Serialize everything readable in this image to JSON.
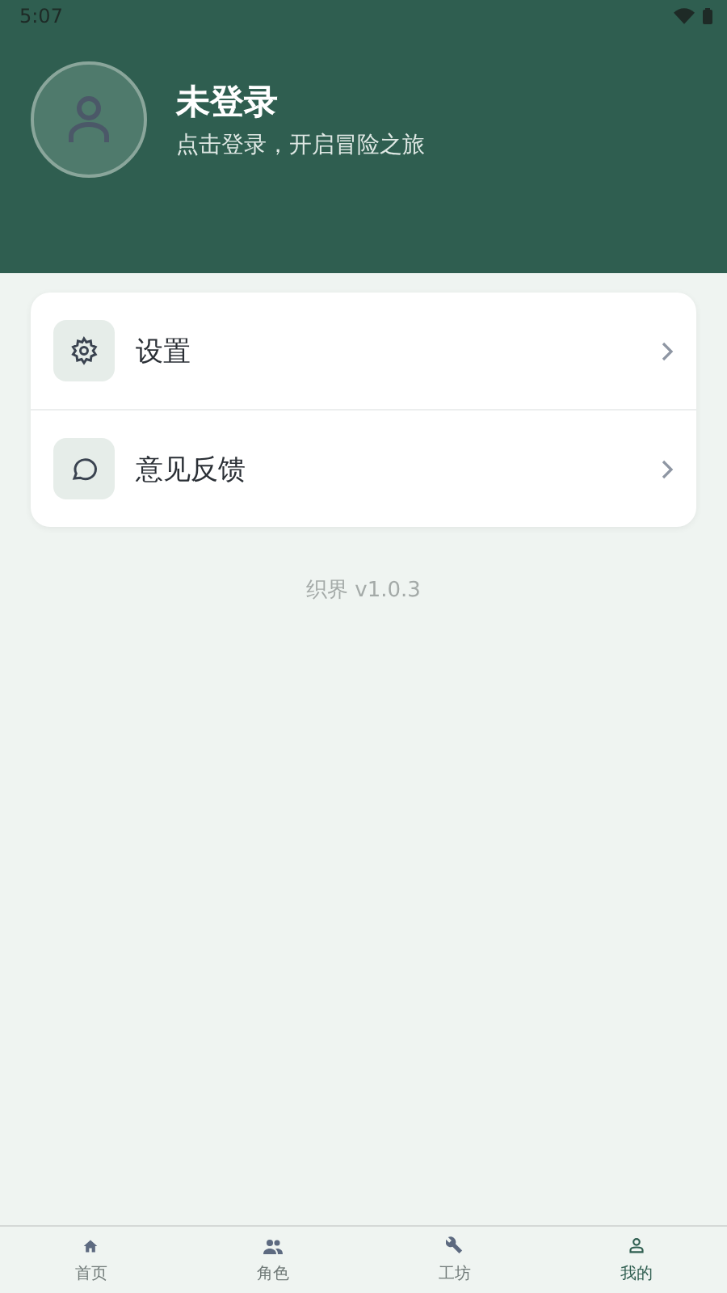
{
  "status_bar": {
    "time": "5:07"
  },
  "profile": {
    "name": "未登录",
    "subtitle": "点击登录，开启冒险之旅"
  },
  "menu": [
    {
      "kind": "settings",
      "label": "设置"
    },
    {
      "kind": "feedback",
      "label": "意见反馈"
    }
  ],
  "version": "织界 v1.0.3",
  "tabs": [
    {
      "kind": "home",
      "label": "首页",
      "selected": false
    },
    {
      "kind": "people",
      "label": "角色",
      "selected": false
    },
    {
      "kind": "wrench",
      "label": "工坊",
      "selected": false
    },
    {
      "kind": "user",
      "label": "我的",
      "selected": true
    }
  ]
}
